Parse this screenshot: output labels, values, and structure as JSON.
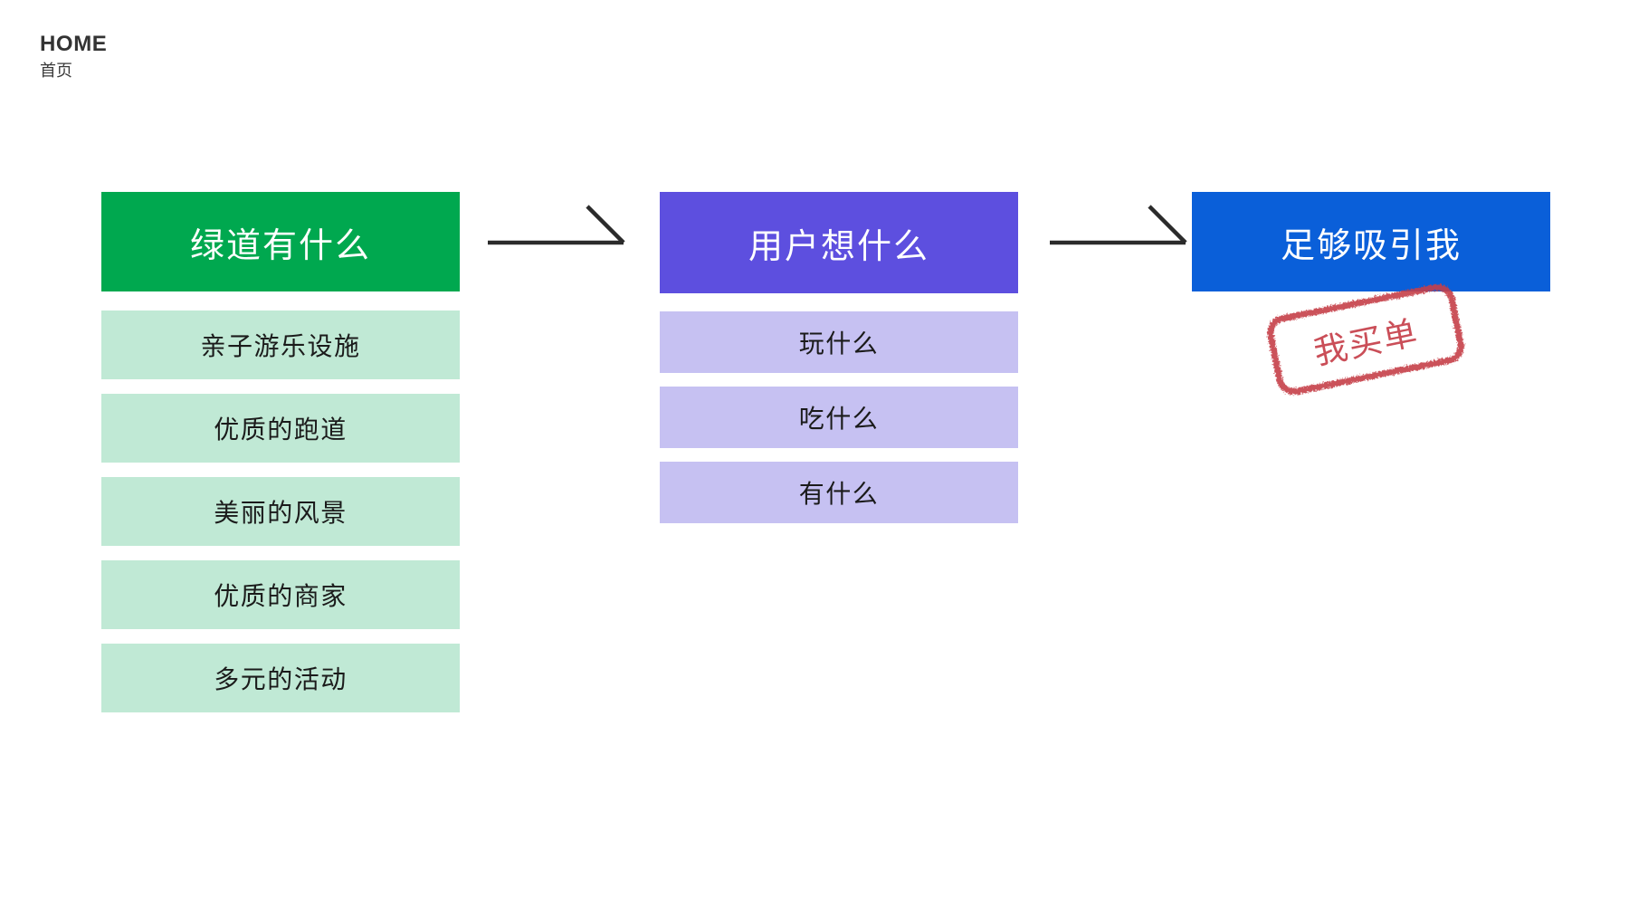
{
  "header": {
    "title": "HOME",
    "subtitle": "首页"
  },
  "colors": {
    "green_header": "#00a84f",
    "green_item": "#c0e9d5",
    "purple_header": "#5d4fdf",
    "purple_item": "#c6c1f2",
    "blue_header": "#0a5fd9",
    "stamp_red": "#c6404a",
    "arrow": "#2b2b2b",
    "text_dark": "#333333"
  },
  "flow": {
    "columns": [
      {
        "header": "绿道有什么",
        "items": [
          "亲子游乐设施",
          "优质的跑道",
          "美丽的风景",
          "优质的商家",
          "多元的活动"
        ]
      },
      {
        "header": "用户想什么",
        "items": [
          "玩什么",
          "吃什么",
          "有什么"
        ]
      },
      {
        "header": "足够吸引我",
        "items": []
      }
    ],
    "arrows": [
      {
        "name": "arrow-green-to-purple"
      },
      {
        "name": "arrow-purple-to-blue"
      }
    ]
  },
  "stamp": {
    "text": "我买单"
  }
}
